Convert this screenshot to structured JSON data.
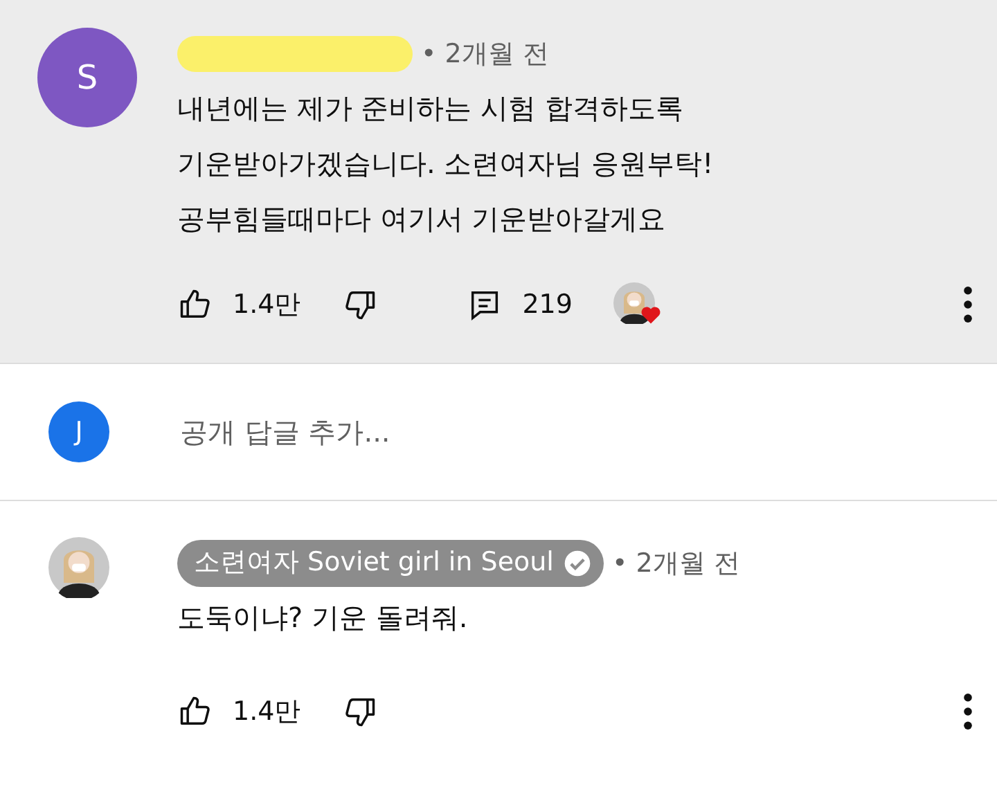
{
  "comment": {
    "avatar_letter": "S",
    "color": "#7e57c2",
    "author_redacted": true,
    "time": "• 2개월 전",
    "lines": [
      "내년에는 제가 준비하는 시험 합격하도록",
      "기운받아가겠습니다. 소련여자님 응원부탁!",
      "공부힘들때마다 여기서 기운받아갈게요"
    ],
    "likes": "1.4만",
    "replies": "219",
    "hearted": true,
    "highlighted": true
  },
  "reply_box": {
    "avatar_letter": "J",
    "color": "#1a73e8",
    "placeholder": "공개 답글 추가..."
  },
  "reply": {
    "author": "소련여자 Soviet girl in Seoul",
    "verified": true,
    "time": "• 2개월 전",
    "lines": [
      "도둑이냐? 기운 돌려줘."
    ],
    "likes": "1.4만"
  }
}
